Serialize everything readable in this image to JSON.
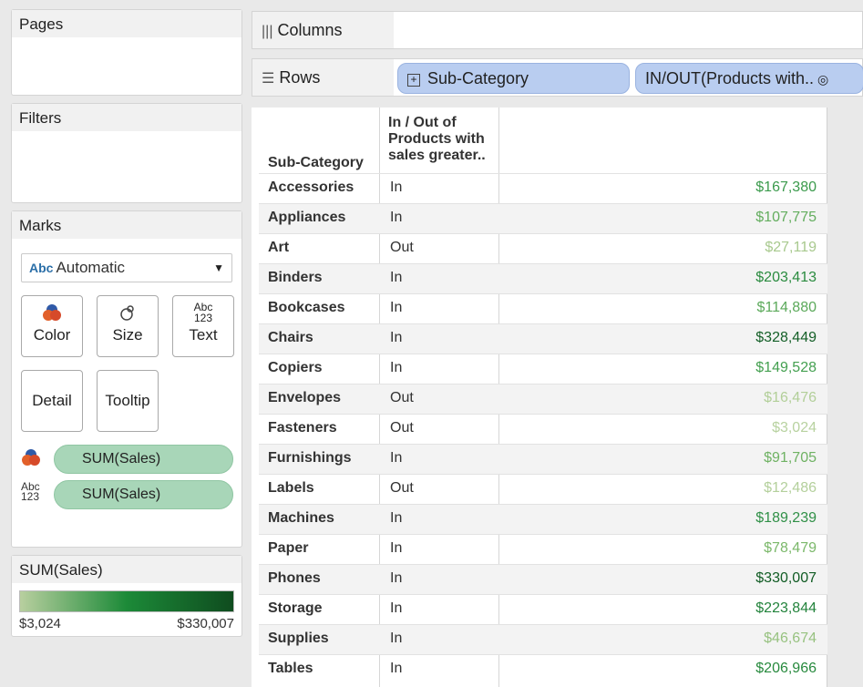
{
  "cards": {
    "pages": "Pages",
    "filters": "Filters",
    "marks": "Marks",
    "mark_type": "Automatic",
    "mark_type_icon_text": "Abc",
    "buttons": {
      "color": "Color",
      "size": "Size",
      "text": "Text",
      "detail": "Detail",
      "tooltip": "Tooltip"
    },
    "text_icon_line1": "Abc",
    "text_icon_line2": "123",
    "pill_color": "SUM(Sales)",
    "pill_text": "SUM(Sales)",
    "legend_title": "SUM(Sales)",
    "legend_min": "$3,024",
    "legend_max": "$330,007"
  },
  "shelves": {
    "columns": "Columns",
    "rows": "Rows",
    "rows_pills": [
      "Sub-Category",
      "IN/OUT(Products with.."
    ]
  },
  "table": {
    "col_header_subcat": "Sub-Category",
    "col_header_inout_1": "In / Out of",
    "col_header_inout_2": "Products with",
    "col_header_inout_3": "sales greater..",
    "rows": [
      {
        "cat": "Accessories",
        "io": "In",
        "val": "$167,380",
        "color": "#3b9a4c"
      },
      {
        "cat": "Appliances",
        "io": "In",
        "val": "$107,775",
        "color": "#63ad5e"
      },
      {
        "cat": "Art",
        "io": "Out",
        "val": "$27,119",
        "color": "#a8c98e"
      },
      {
        "cat": "Binders",
        "io": "In",
        "val": "$203,413",
        "color": "#2a8b3f"
      },
      {
        "cat": "Bookcases",
        "io": "In",
        "val": "$114,880",
        "color": "#5ba95a"
      },
      {
        "cat": "Chairs",
        "io": "In",
        "val": "$328,449",
        "color": "#145f27"
      },
      {
        "cat": "Copiers",
        "io": "In",
        "val": "$149,528",
        "color": "#44a050"
      },
      {
        "cat": "Envelopes",
        "io": "Out",
        "val": "$16,476",
        "color": "#b2cf99"
      },
      {
        "cat": "Fasteners",
        "io": "Out",
        "val": "$3,024",
        "color": "#b8d2a0"
      },
      {
        "cat": "Furnishings",
        "io": "In",
        "val": "$91,705",
        "color": "#6fb263"
      },
      {
        "cat": "Labels",
        "io": "Out",
        "val": "$12,486",
        "color": "#b4d09c"
      },
      {
        "cat": "Machines",
        "io": "In",
        "val": "$189,239",
        "color": "#309047"
      },
      {
        "cat": "Paper",
        "io": "In",
        "val": "$78,479",
        "color": "#7bb86a"
      },
      {
        "cat": "Phones",
        "io": "In",
        "val": "$330,007",
        "color": "#115c24"
      },
      {
        "cat": "Storage",
        "io": "In",
        "val": "$223,844",
        "color": "#23833c"
      },
      {
        "cat": "Supplies",
        "io": "In",
        "val": "$46,674",
        "color": "#97c280"
      },
      {
        "cat": "Tables",
        "io": "In",
        "val": "$206,966",
        "color": "#288a3e"
      }
    ]
  }
}
